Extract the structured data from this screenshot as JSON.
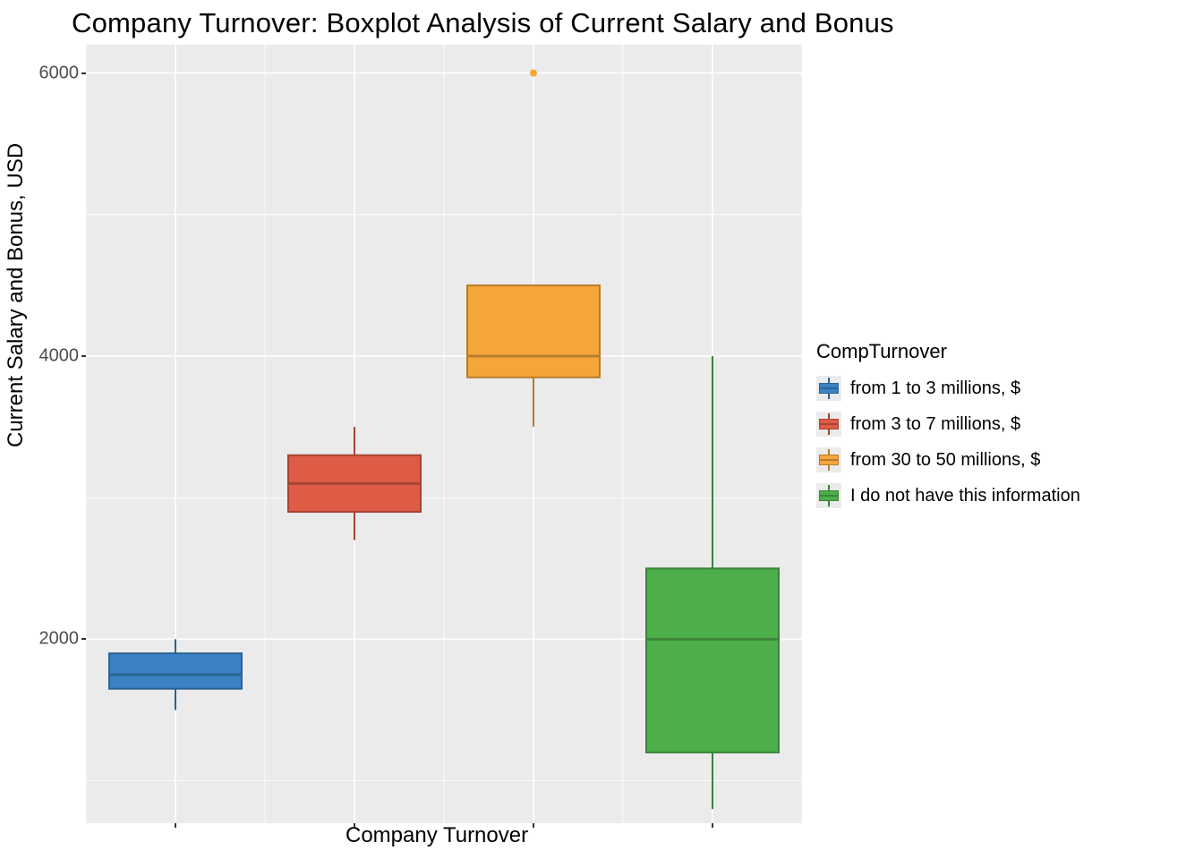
{
  "chart_data": {
    "type": "boxplot",
    "title": "Company Turnover: Boxplot Analysis of Current Salary and Bonus",
    "xlabel": "Company Turnover",
    "ylabel": "Current Salary and Bonus, USD",
    "y_ticks": [
      2000,
      4000,
      6000
    ],
    "ylim": [
      700,
      6200
    ],
    "legend_title": "CompTurnover",
    "categories": [
      "from 1 to 3 millions, $",
      "from 3 to 7 millions, $",
      "from 30 to 50 millions, $",
      "I do not have this information"
    ],
    "series": [
      {
        "name": "from 1 to 3 millions, $",
        "color": "#3b82c4",
        "whisker_low": 1500,
        "q1": 1650,
        "median": 1750,
        "q3": 1900,
        "whisker_high": 2000,
        "outliers": []
      },
      {
        "name": "from 3 to 7 millions, $",
        "color": "#de5b45",
        "whisker_low": 2700,
        "q1": 2900,
        "median": 3100,
        "q3": 3300,
        "whisker_high": 3500,
        "outliers": []
      },
      {
        "name": "from 30 to 50 millions, $",
        "color": "#f4a63a",
        "whisker_low": 3500,
        "q1": 3850,
        "median": 4000,
        "q3": 4500,
        "whisker_high": 4500,
        "outliers": [
          6000
        ]
      },
      {
        "name": "I do not have this information",
        "color": "#4daf4a",
        "whisker_low": 800,
        "q1": 1200,
        "median": 2000,
        "q3": 2500,
        "whisker_high": 4000,
        "outliers": []
      }
    ]
  }
}
